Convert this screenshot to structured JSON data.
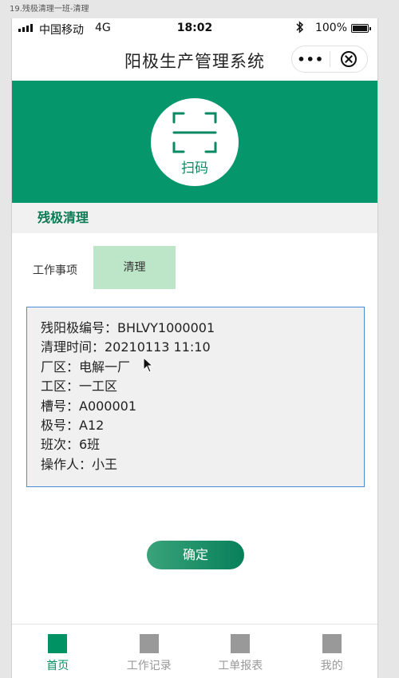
{
  "window_caption": "19.残极清理一班-清理",
  "status_bar": {
    "carrier": "中国移动",
    "network": "4G",
    "time": "18:02",
    "bluetooth_icon": "bluetooth-icon",
    "battery": "100%"
  },
  "header": {
    "title": "阳极生产管理系统",
    "more_icon": "•••"
  },
  "scan": {
    "label": "扫码",
    "icon": "scan-icon"
  },
  "section": {
    "title": "残极清理"
  },
  "work": {
    "label": "工作事项",
    "item": "清理"
  },
  "info": {
    "lines": [
      "残阳极编号：BHLVY1000001",
      "清理时间：20210113 11:10",
      "厂区：电解一厂",
      "工区：一工区",
      "槽号：A000001",
      "极号：A12",
      "班次：6班",
      "操作人：小王"
    ]
  },
  "confirm_label": "确定",
  "tabs": [
    {
      "label": "首页",
      "active": true
    },
    {
      "label": "工作记录",
      "active": false
    },
    {
      "label": "工单报表",
      "active": false
    },
    {
      "label": "我的",
      "active": false
    }
  ],
  "colors": {
    "brand_green": "#05966c",
    "chip_green": "#bde6c8",
    "card_border": "#4a8fd6",
    "tab_active": "#009262",
    "tab_inactive": "#999999"
  }
}
